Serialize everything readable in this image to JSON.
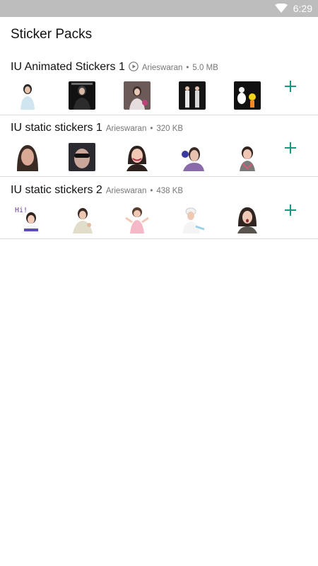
{
  "status_bar": {
    "time": "6:29",
    "wifi_icon": "wifi-icon"
  },
  "page": {
    "title": "Sticker Packs"
  },
  "packs": [
    {
      "name": "IU Animated Stickers 1",
      "animated": true,
      "publisher": "Arieswaran",
      "size": "5.0 MB",
      "separator": "•",
      "stickers": [
        "sticker-photo",
        "sticker-photo",
        "sticker-photo",
        "sticker-photo",
        "sticker-photo"
      ]
    },
    {
      "name": "IU static stickers 1",
      "animated": false,
      "publisher": "Arieswaran",
      "size": "320 KB",
      "separator": "•",
      "stickers": [
        "sticker-photo",
        "sticker-photo",
        "sticker-photo",
        "sticker-photo",
        "sticker-photo"
      ]
    },
    {
      "name": "IU static stickers 2",
      "animated": false,
      "publisher": "Arieswaran",
      "size": "438 KB",
      "separator": "•",
      "sticker_text": "Hi!",
      "stickers": [
        "sticker-photo",
        "sticker-photo",
        "sticker-photo",
        "sticker-photo",
        "sticker-photo"
      ]
    }
  ],
  "colors": {
    "accent": "#19997d",
    "status_bar": "#bdbdbd"
  }
}
